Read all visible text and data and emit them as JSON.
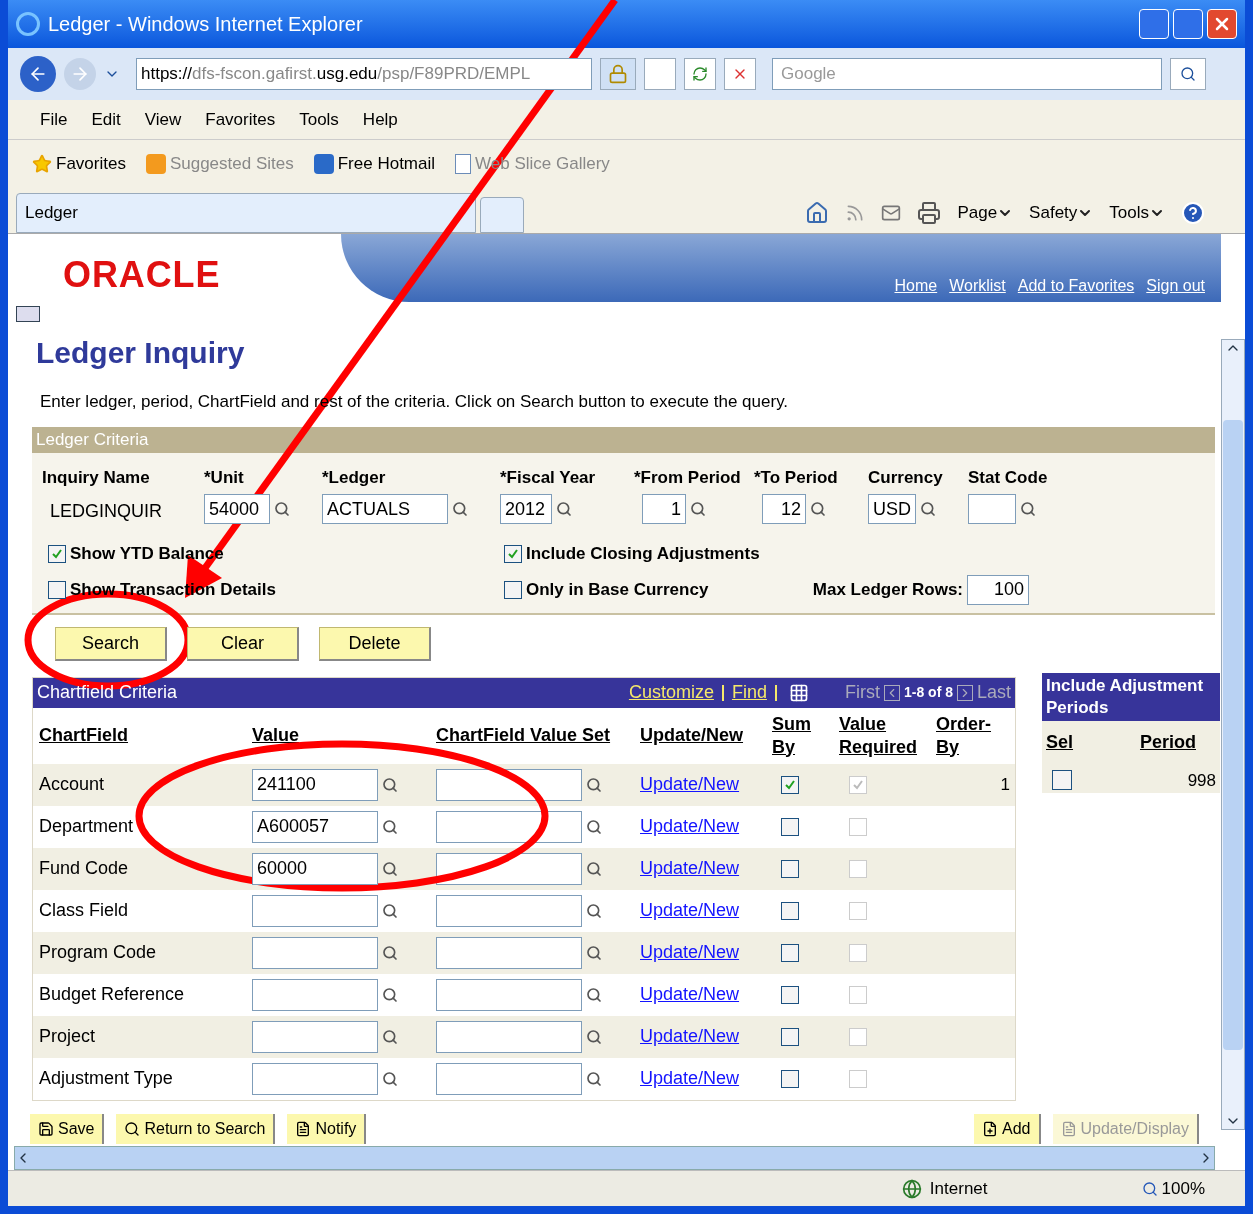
{
  "window": {
    "title": "Ledger - Windows Internet Explorer"
  },
  "address_bar": {
    "scheme": "https://",
    "host_start": "dfs-fscon.gafirst.",
    "domain": "usg.edu",
    "path": "/psp/F89PRD/EMPL"
  },
  "search": {
    "placeholder": "Google"
  },
  "menu": [
    "File",
    "Edit",
    "View",
    "Favorites",
    "Tools",
    "Help"
  ],
  "favorites_bar": [
    {
      "label": "Favorites",
      "kind": "favorites"
    },
    {
      "label": "Suggested Sites",
      "kind": "suggested"
    },
    {
      "label": "Free Hotmail",
      "kind": "hotmail"
    },
    {
      "label": "Web Slice Gallery",
      "kind": "slice"
    }
  ],
  "tab": {
    "label": "Ledger"
  },
  "command_bar": [
    "Page",
    "Safety",
    "Tools"
  ],
  "page": {
    "logo": "ORACLE",
    "nav_links": [
      "Home",
      "Worklist",
      "Add to Favorites",
      "Sign out"
    ],
    "title": "Ledger Inquiry",
    "instructions": "Enter ledger, period, ChartField and rest of the criteria. Click on Search button to execute the query.",
    "ledger_criteria": {
      "title": "Ledger Criteria",
      "fields": [
        {
          "label": "Inquiry Name",
          "value": "LEDGINQUIR",
          "kind": "text"
        },
        {
          "label": "*Unit",
          "value": "54000",
          "kind": "lookup"
        },
        {
          "label": "*Ledger",
          "value": "ACTUALS",
          "kind": "lookup"
        },
        {
          "label": "*Fiscal Year",
          "value": "2012",
          "kind": "lookup"
        },
        {
          "label": "*From Period",
          "value": "1",
          "kind": "lookup"
        },
        {
          "label": "*To Period",
          "value": "12",
          "kind": "lookup"
        },
        {
          "label": "Currency",
          "value": "USD",
          "kind": "lookup"
        },
        {
          "label": "Stat Code",
          "kind": "lookup"
        }
      ],
      "options": [
        {
          "label": "Show YTD Balance",
          "checked": true
        },
        {
          "label": "Include Closing Adjustments",
          "checked": true
        },
        {
          "label": "Show Transaction Details",
          "checked": false
        },
        {
          "label": "Only in Base Currency",
          "checked": false
        }
      ],
      "max_rows": {
        "label": "Max Ledger Rows:",
        "value": "100"
      }
    },
    "buttons": [
      "Search",
      "Clear",
      "Delete"
    ],
    "chartfield_criteria": {
      "title": "Chartfield Criteria",
      "links": [
        "Customize",
        "Find"
      ],
      "first": "First",
      "range": "1-8 of 8",
      "last": "Last",
      "columns": [
        "ChartField",
        "Value",
        "ChartField Value Set",
        "Update/New",
        "Sum By",
        "Value Required",
        "Order-By"
      ],
      "rows": [
        {
          "chartfield": "Account",
          "value": "241100",
          "link": "Update/New",
          "sum_by": true,
          "value_required": true,
          "order_by": "1"
        },
        {
          "chartfield": "Department",
          "value": "A600057",
          "link": "Update/New",
          "sum_by": false,
          "value_required": false
        },
        {
          "chartfield": "Fund Code",
          "value": "60000",
          "link": "Update/New",
          "sum_by": false,
          "value_required": false
        },
        {
          "chartfield": "Class Field",
          "value": "",
          "link": "Update/New",
          "sum_by": false,
          "value_required": false
        },
        {
          "chartfield": "Program Code",
          "value": "",
          "link": "Update/New",
          "sum_by": false,
          "value_required": false
        },
        {
          "chartfield": "Budget Reference",
          "value": "",
          "link": "Update/New",
          "sum_by": false,
          "value_required": false
        },
        {
          "chartfield": "Project",
          "value": "",
          "link": "Update/New",
          "sum_by": false,
          "value_required": false
        },
        {
          "chartfield": "Adjustment Type",
          "value": "",
          "link": "Update/New",
          "sum_by": false,
          "value_required": false
        }
      ]
    },
    "adjustment_periods": {
      "title": "Include Adjustment Periods",
      "columns": [
        "Sel",
        "Period"
      ],
      "rows": [
        {
          "selected": false,
          "period": "998"
        }
      ]
    },
    "toolbar": [
      {
        "label": "Save",
        "disabled": false
      },
      {
        "label": "Return to Search",
        "disabled": false
      },
      {
        "label": "Notify",
        "disabled": false
      },
      {
        "label": "Add",
        "disabled": false
      },
      {
        "label": "Update/Display",
        "disabled": true
      }
    ]
  },
  "status_bar": {
    "zone": "Internet",
    "zoom": "100%"
  }
}
